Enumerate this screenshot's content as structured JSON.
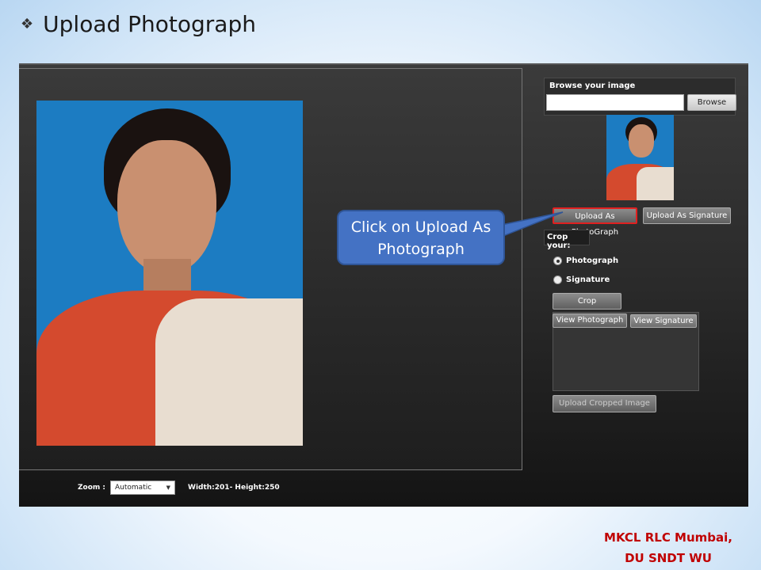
{
  "slide": {
    "title": "Upload Photograph",
    "bullet_icon": "diamond-bullet-icon"
  },
  "browse": {
    "label": "Browse your image",
    "input_value": "",
    "button_label": "Browse"
  },
  "upload_buttons": {
    "photo_label": "Upload As PhotoGraph",
    "signature_label": "Upload As Signature"
  },
  "crop": {
    "label": "Crop your:",
    "options": [
      {
        "label": "Photograph",
        "checked": true
      },
      {
        "label": "Signature",
        "checked": false
      }
    ],
    "button_label": "Crop"
  },
  "view": {
    "photo_tab": "View Photograph",
    "signature_tab": "View Signature"
  },
  "upload_cropped_label": "Upload Cropped Image",
  "zoom": {
    "label": "Zoom :",
    "selected": "Automatic",
    "dimensions": "Width:201- Height:250"
  },
  "callout": {
    "text": "Click on Upload As Photograph"
  },
  "footer": {
    "line1": "MKCL RLC Mumbai,",
    "line2": "DU SNDT WU"
  },
  "colors": {
    "callout_fill": "#4472c4",
    "highlight_border": "#e02020",
    "footer_text": "#c00000"
  }
}
